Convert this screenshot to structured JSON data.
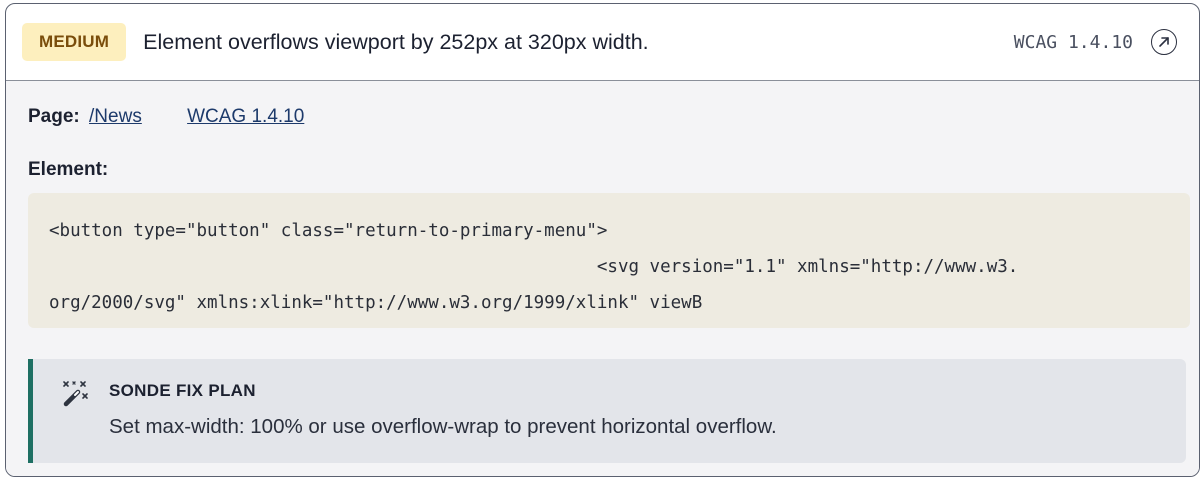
{
  "issue": {
    "severity": "MEDIUM",
    "title": "Element overflows viewport by 252px at 320px width.",
    "wcag_code": "WCAG 1.4.10",
    "link_icon": "external-link-icon"
  },
  "details": {
    "page_label": "Page:",
    "page_link": "/News",
    "wcag_link": "WCAG 1.4.10",
    "element_label": "Element:",
    "element_code": "<button type=\"button\" class=\"return-to-primary-menu\">\n                                                    <svg version=\"1.1\" xmlns=\"http://www.w3.\norg/2000/svg\" xmlns:xlink=\"http://www.w3.org/1999/xlink\" viewB"
  },
  "fix_plan": {
    "icon": "magic-wand-icon",
    "title": "SONDE FIX PLAN",
    "text": "Set max-width: 100% or use overflow-wrap to prevent horizontal overflow."
  },
  "colors": {
    "badge_bg": "#fdefbe",
    "badge_text": "#7a4d0b",
    "link": "#1d3a6b",
    "fix_accent": "#1e6f63",
    "code_bg": "#eeebe1"
  }
}
